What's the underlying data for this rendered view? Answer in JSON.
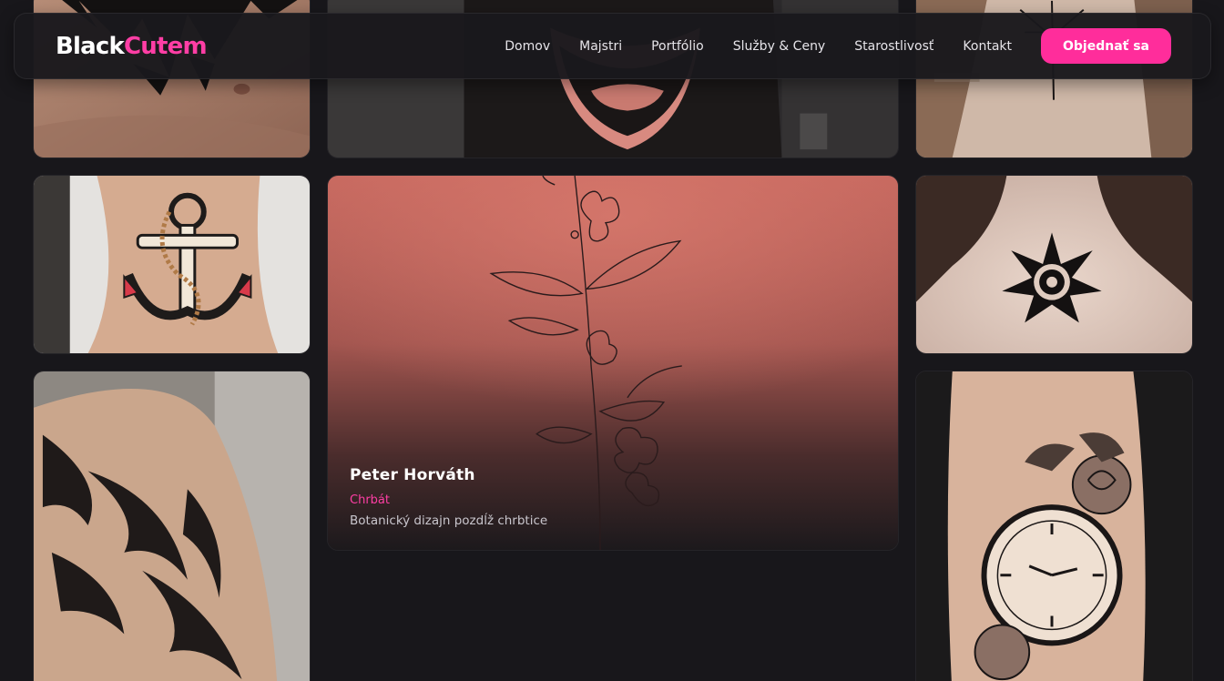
{
  "brand": {
    "part1": "Black",
    "part2": "Cutem"
  },
  "nav": {
    "links": [
      "Domov",
      "Majstri",
      "Portfólio",
      "Služby & Ceny",
      "Starostlivosť",
      "Kontakt"
    ],
    "cta": "Objednať sa"
  },
  "featured": {
    "artist": "Peter Horváth",
    "placement": "Chrbát",
    "description": "Botanický dizajn pozdĺž chrbtice"
  },
  "colors": {
    "background": "#18171b",
    "accent": "#ff2d9b",
    "accent_text": "#ff3ea5"
  },
  "gallery": [
    {
      "name": "chest-tattoo"
    },
    {
      "name": "beard-portrait"
    },
    {
      "name": "neck-tattoo"
    },
    {
      "name": "anchor-tattoo"
    },
    {
      "name": "botanical-back-tattoo"
    },
    {
      "name": "mandala-tattoo"
    },
    {
      "name": "tribal-arm-tattoo"
    },
    {
      "name": "clock-rose-tattoo"
    }
  ]
}
